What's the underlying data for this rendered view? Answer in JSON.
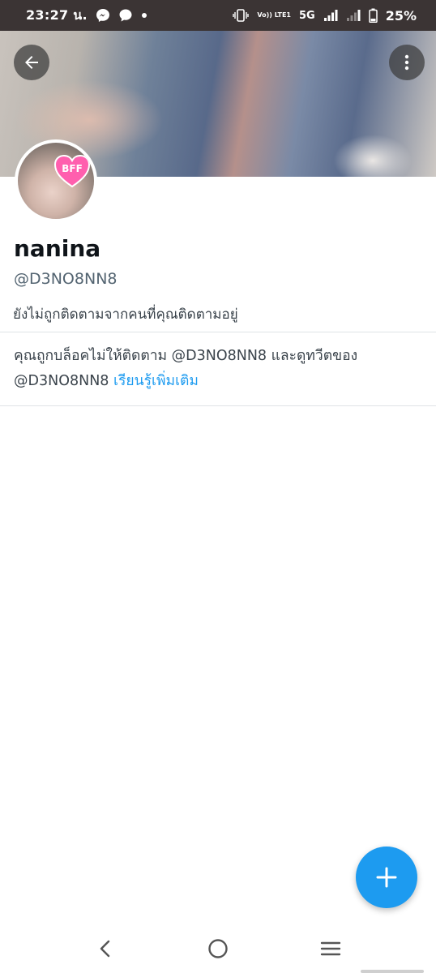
{
  "status_bar": {
    "time": "23:27 น.",
    "network": "5G",
    "volte": "Vo)) LTE1",
    "battery": "25%"
  },
  "header": {
    "back_icon": "arrow-left-icon",
    "more_icon": "more-vertical-icon"
  },
  "avatar": {
    "badge": "BFF"
  },
  "profile": {
    "display_name": "nanina",
    "handle": "@D3NO8NN8",
    "follow_status": "ยังไม่ถูกติดตามจากคนที่คุณติดตามอยู่"
  },
  "blocked_notice": {
    "line1": "คุณถูกบล็อคไม่ให้ติดตาม @D3NO8NN8 และดูทวีตของ",
    "line2_handle": "@D3NO8NN8",
    "learn_more": "เรียนรู้เพิ่มเติม"
  },
  "fab": {
    "icon": "plus-icon"
  },
  "nav": {
    "back_icon": "nav-back-icon",
    "home_icon": "nav-home-icon",
    "recents_icon": "nav-recents-icon"
  },
  "colors": {
    "accent": "#1d9bf0",
    "status_bar": "#3b3434",
    "text_primary": "#0f1419",
    "text_secondary": "#536471"
  }
}
